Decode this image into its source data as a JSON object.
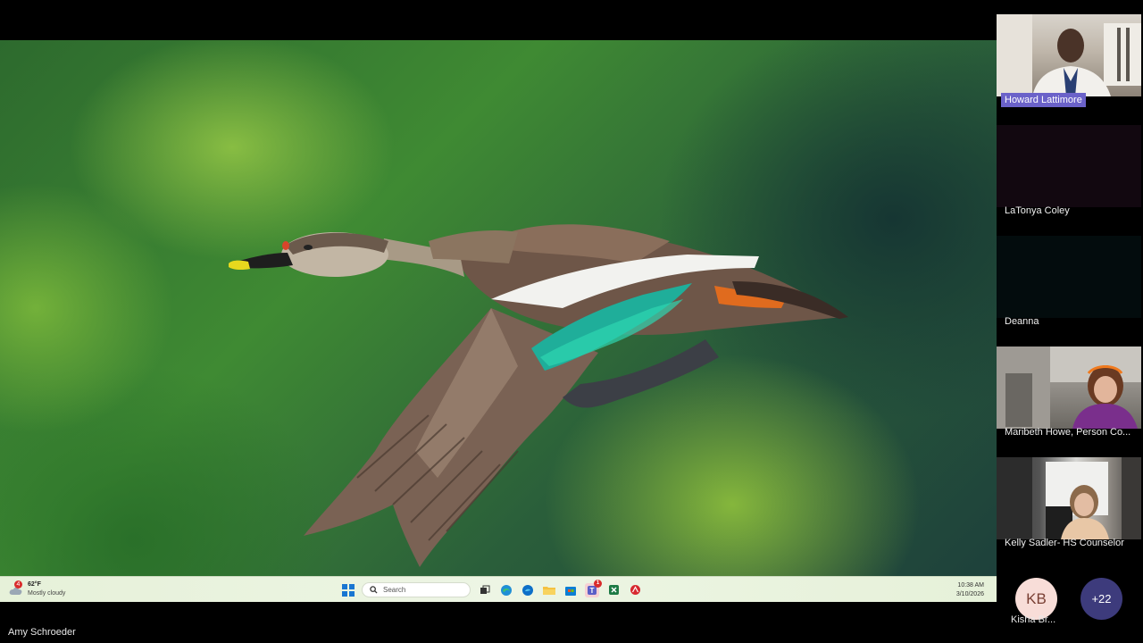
{
  "presenter": {
    "name": "Amy Schroeder"
  },
  "taskbar": {
    "weather_badge": "4",
    "temperature": "62°F",
    "condition": "Mostly cloudy",
    "search_placeholder": "Search",
    "teams_badge": "1",
    "time": "10:38 AM",
    "date": "3/10/2026"
  },
  "participants": [
    {
      "name": "Howard Lattimore",
      "video": true
    },
    {
      "name": "LaTonya Coley",
      "video": false
    },
    {
      "name": "Deanna",
      "video": false
    },
    {
      "name": "Maribeth Howe, Person Co...",
      "video": true
    },
    {
      "name": "Kelly Sadler- HS Counselor",
      "video": true
    }
  ],
  "overflow": {
    "avatar_initials": "KB",
    "avatar_name": "Kisha Br...",
    "more_count": "+22"
  },
  "colors": {
    "namebar_accent": "#6b62c9",
    "overflow_button": "#3d3b7c",
    "avatar_bg": "#f8ddd8"
  }
}
